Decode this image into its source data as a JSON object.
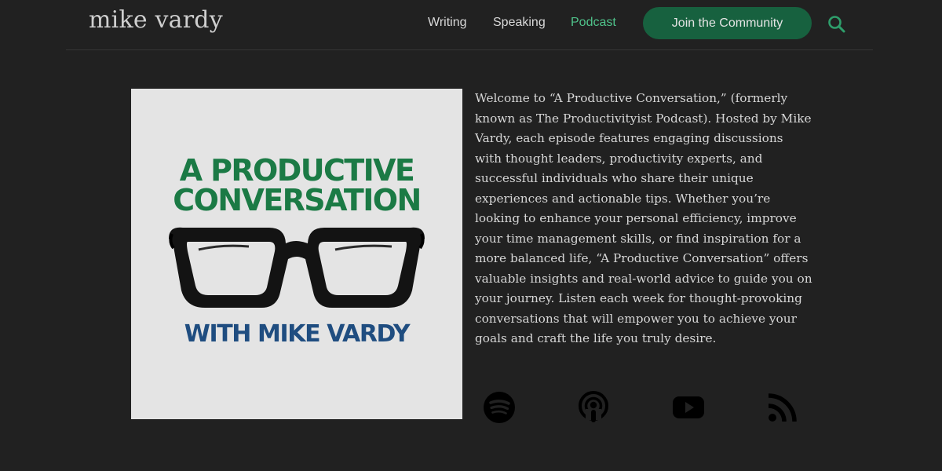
{
  "header": {
    "logo": "mike vardy",
    "nav": [
      {
        "label": "Writing",
        "active": false
      },
      {
        "label": "Speaking",
        "active": false
      },
      {
        "label": "Podcast",
        "active": true
      }
    ],
    "cta_label": "Join the Community",
    "search_icon": "search-icon"
  },
  "cover": {
    "title_line1": "A PRODUCTIVE",
    "title_line2": "CONVERSATION",
    "subtitle": "WITH MIKE VARDY",
    "image": "glasses"
  },
  "description": "Welcome to “A Productive Conversation,” (formerly known as The Productivityist Podcast). Hosted by Mike Vardy, each episode features engaging discussions with thought leaders, productivity experts, and successful individuals who share their unique experiences and actionable tips. Whether you’re looking to enhance your personal efficiency, improve your time management skills, or find inspiration for a more balanced life, “A Productive Conversation” offers valuable insights and real-world advice to guide you on your journey. Listen each week for thought-provoking conversations that will empower you to achieve your goals and craft the life you truly desire.",
  "platforms": [
    {
      "icon": "spotify-icon"
    },
    {
      "icon": "apple-podcasts-icon"
    },
    {
      "icon": "youtube-icon"
    },
    {
      "icon": "rss-icon"
    }
  ],
  "colors": {
    "background": "#212121",
    "accent": "#4fc28a",
    "cta_background": "#17613f",
    "cover_title": "#1b7a45",
    "cover_subtitle": "#1f4d80"
  }
}
